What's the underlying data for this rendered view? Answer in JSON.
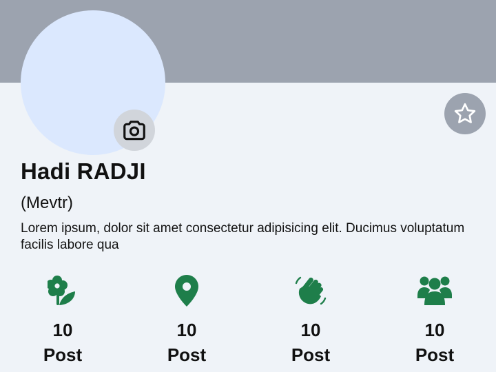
{
  "profile": {
    "name": "Hadi RADJI",
    "nickname": "(Mevtr)",
    "bio": "Lorem ipsum, dolor sit amet consectetur adipisicing elit. Ducimus voluptatum facilis labore qua"
  },
  "icons": {
    "camera": "camera-icon",
    "favorite": "star-icon"
  },
  "stats": [
    {
      "icon": "flower-icon",
      "count": "10",
      "label": "Post"
    },
    {
      "icon": "map-pin-icon",
      "count": "10",
      "label": "Post"
    },
    {
      "icon": "waving-hand-icon",
      "count": "10",
      "label": "Post"
    },
    {
      "icon": "users-icon",
      "count": "10",
      "label": "Post"
    }
  ],
  "colors": {
    "cover": "#9ca3af",
    "background": "#eff3f8",
    "avatar": "#dbe8fe",
    "accent_green": "#1e7e4a",
    "camera_button": "#d1d5db",
    "star_button": "#9ca3af"
  }
}
